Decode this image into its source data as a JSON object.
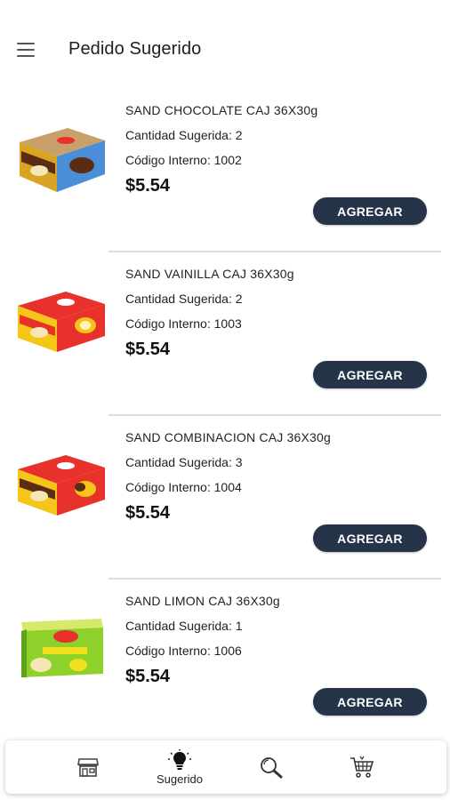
{
  "header": {
    "title": "Pedido Sugerido",
    "menu_icon": "hamburger-menu-icon"
  },
  "products": [
    {
      "name": "SAND CHOCOLATE CAJ 36X30g",
      "qty": "Cantidad Sugerida: 2",
      "code": "Código Interno: 1002",
      "price": "$5.54",
      "button": "AGREGAR",
      "box_color": "#d9a424",
      "box_accent": "#5a2d12"
    },
    {
      "name": "SAND VAINILLA CAJ 36X30g",
      "qty": "Cantidad Sugerida: 2",
      "code": "Código Interno: 1003",
      "price": "$5.54",
      "button": "AGREGAR",
      "box_color": "#e8312b",
      "box_accent": "#f5c518"
    },
    {
      "name": "SAND COMBINACION CAJ 36X30g",
      "qty": "Cantidad Sugerida: 3",
      "code": "Código Interno: 1004",
      "price": "$5.54",
      "button": "AGREGAR",
      "box_color": "#e8312b",
      "box_accent": "#f5c518"
    },
    {
      "name": "SAND LIMON CAJ 36X30g",
      "qty": "Cantidad Sugerida: 1",
      "code": "Código Interno: 1006",
      "price": "$5.54",
      "button": "AGREGAR",
      "box_color": "#8fd12b",
      "box_accent": "#f0e020"
    }
  ],
  "bottom_nav": [
    {
      "icon": "store-icon",
      "label": ""
    },
    {
      "icon": "lightbulb-icon",
      "label": "Sugerido"
    },
    {
      "icon": "search-icon",
      "label": ""
    },
    {
      "icon": "cart-icon",
      "label": ""
    }
  ],
  "colors": {
    "button_bg": "#26344a",
    "divider": "#dcdcdc"
  }
}
